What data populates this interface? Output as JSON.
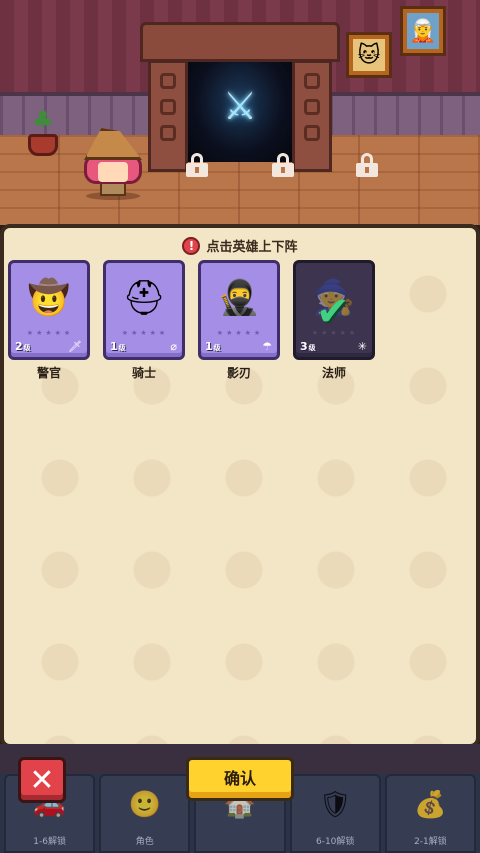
{
  "scene": {
    "portal_icon": "crossed-swords-icon",
    "frames": [
      "cat-portrait",
      "knight-portrait"
    ],
    "locks_count": 3
  },
  "panel": {
    "hint_text": "点击英雄上下阵",
    "hint_icon": "!",
    "heroes": [
      {
        "name": "警官",
        "level": "2",
        "level_unit": "级",
        "stars": "★★★★★",
        "element_icon": "🗡",
        "glyph": "🤠",
        "selected": false
      },
      {
        "name": "骑士",
        "level": "1",
        "level_unit": "级",
        "stars": "★★★★★",
        "element_icon": "⌀",
        "glyph": "⛑",
        "selected": false
      },
      {
        "name": "影刃",
        "level": "1",
        "level_unit": "级",
        "stars": "★★★★★",
        "element_icon": "☂",
        "glyph": "🥷",
        "selected": false
      },
      {
        "name": "法师",
        "level": "3",
        "level_unit": "级",
        "stars": "★★★★★",
        "element_icon": "✳",
        "glyph": "🧙",
        "selected": true
      }
    ]
  },
  "buttons": {
    "close_label": "✕",
    "confirm_label": "确认"
  },
  "tabbar": {
    "tabs": [
      {
        "label": "1-6解锁",
        "icon": "🚗"
      },
      {
        "label": "角色",
        "icon": "🙂"
      },
      {
        "label": "",
        "icon": "🏠"
      },
      {
        "label": "6-10解锁",
        "icon": "🛡"
      },
      {
        "label": "2-1解锁",
        "icon": "💰"
      }
    ]
  },
  "colors": {
    "card_bg": "#a58ee6",
    "card_selected_bg": "#3d3550",
    "confirm_yellow": "#ffd22e",
    "close_red": "#e2434a",
    "panel_bg": "#f3e6c6"
  }
}
